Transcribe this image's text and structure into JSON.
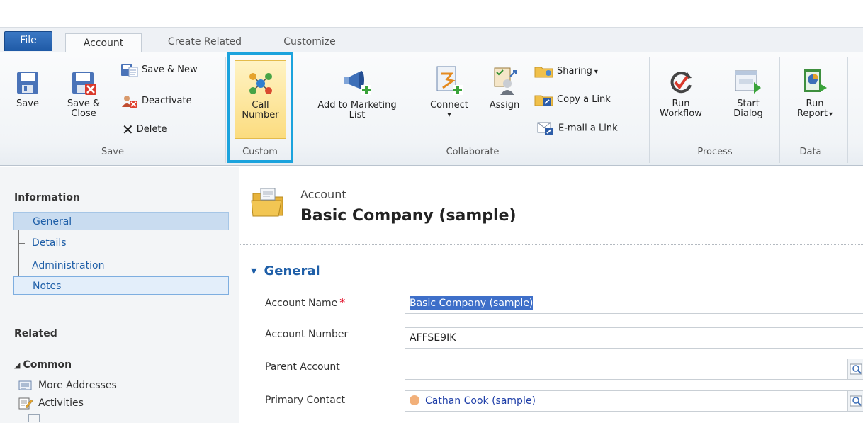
{
  "tabs": {
    "file": "File",
    "account": "Account",
    "create_related": "Create Related",
    "customize": "Customize"
  },
  "ribbon": {
    "save_group": {
      "label": "Save",
      "save": "Save",
      "save_close_1": "Save &",
      "save_close_2": "Close",
      "save_new": "Save & New",
      "deactivate": "Deactivate",
      "delete": "Delete"
    },
    "custom_group": {
      "label": "Custom",
      "call_1": "Call",
      "call_2": "Number"
    },
    "collaborate_group": {
      "label": "Collaborate",
      "add_marketing_1": "Add to Marketing",
      "add_marketing_2": "List",
      "connect": "Connect",
      "assign": "Assign",
      "sharing": "Sharing",
      "copy_link": "Copy a Link",
      "email_link": "E-mail a Link"
    },
    "process_group": {
      "label": "Process",
      "run_workflow_1": "Run",
      "run_workflow_2": "Workflow",
      "start_dialog_1": "Start",
      "start_dialog_2": "Dialog"
    },
    "data_group": {
      "label": "Data",
      "run_report_1": "Run",
      "run_report_2": "Report"
    }
  },
  "nav": {
    "information_heading": "Information",
    "items": [
      "General",
      "Details",
      "Administration",
      "Notes"
    ],
    "related_heading": "Related",
    "common_heading": "Common",
    "common_items": [
      "More Addresses",
      "Activities"
    ]
  },
  "header": {
    "entity": "Account",
    "record_name": "Basic Company (sample)"
  },
  "section": {
    "title": "General"
  },
  "form": {
    "account_name_label": "Account Name",
    "account_name_value": "Basic Company (sample)",
    "account_number_label": "Account Number",
    "account_number_value": "AFFSE9IK",
    "parent_account_label": "Parent Account",
    "parent_account_value": "",
    "primary_contact_label": "Primary Contact",
    "primary_contact_value": "Cathan Cook (sample)"
  },
  "colors": {
    "accent": "#1f5fa8",
    "highlight_border": "#1ba3dd",
    "required": "#e0001b"
  }
}
